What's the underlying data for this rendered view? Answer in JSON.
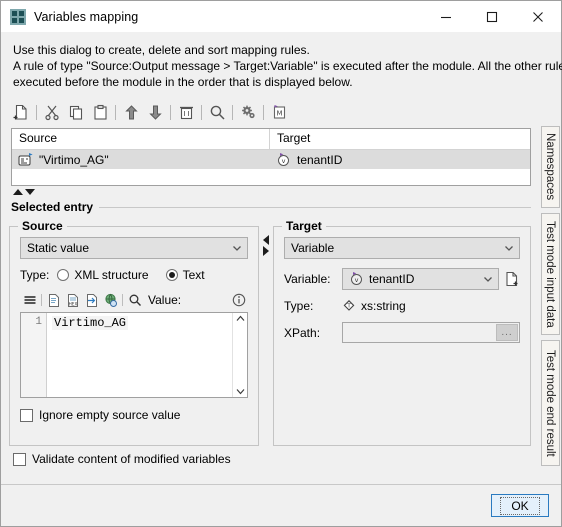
{
  "window": {
    "title": "Variables mapping",
    "icon": "app-icon",
    "controls": {
      "minimize": "minimize-icon",
      "maximize": "maximize-icon",
      "close": "close-icon"
    }
  },
  "description": {
    "line1": "Use this dialog to create, delete and sort mapping rules.",
    "line2": "A rule of type \"Source:Output message > Target:Variable\" is executed after the module. All the other rules get",
    "line3": "executed before the module in the order that is displayed below."
  },
  "toolbar": {
    "buttons": [
      {
        "name": "new-rule-icon",
        "tip": "New"
      },
      {
        "name": "cut-icon",
        "tip": "Cut"
      },
      {
        "name": "copy-icon",
        "tip": "Copy"
      },
      {
        "name": "paste-icon",
        "tip": "Paste"
      },
      {
        "name": "move-up-icon",
        "tip": "Move up"
      },
      {
        "name": "move-down-icon",
        "tip": "Move down"
      },
      {
        "name": "delete-icon",
        "tip": "Delete"
      },
      {
        "name": "search-icon",
        "tip": "Search"
      },
      {
        "name": "settings-icon",
        "tip": "Settings"
      },
      {
        "name": "module-icon",
        "tip": "Module"
      }
    ]
  },
  "rules_table": {
    "columns": [
      "Source",
      "Target"
    ],
    "rows": [
      {
        "source": "\"Virtimo_AG\"",
        "source_icon": "static-value-icon",
        "target": "tenantID",
        "target_icon": "variable-icon",
        "selected": true
      }
    ]
  },
  "selected_entry": {
    "legend": "Selected entry",
    "source": {
      "legend": "Source",
      "type_combo_value": "Static value",
      "type_label": "Type:",
      "radio_xml_label": "XML structure",
      "radio_text_label": "Text",
      "selected_radio": "Text",
      "mini_toolbar": [
        {
          "name": "format-lines-icon"
        },
        {
          "name": "document-icon"
        },
        {
          "name": "hex-document-icon"
        },
        {
          "name": "import-document-icon"
        },
        {
          "name": "link-globe-icon"
        },
        {
          "name": "search-icon"
        }
      ],
      "value_label": "Value:",
      "info_icon": "info-icon",
      "editor": {
        "line_number": "1",
        "text": "Virtimo_AG"
      },
      "ignore_empty_label": "Ignore empty source value",
      "ignore_empty_checked": false
    },
    "target": {
      "legend": "Target",
      "type_combo_value": "Variable",
      "variable_label": "Variable:",
      "variable_value": "tenantID",
      "variable_icon": "variable-icon",
      "new_variable_icon": "new-document-icon",
      "type_label": "Type:",
      "type_value": "xs:string",
      "type_value_icon": "type-icon",
      "xpath_label": "XPath:",
      "xpath_value": "",
      "xpath_browse_label": "..."
    }
  },
  "side_tabs": [
    {
      "label": "Namespaces"
    },
    {
      "label": "Test mode input data"
    },
    {
      "label": "Test mode end result"
    }
  ],
  "footer": {
    "validate_label": "Validate content of modified variables",
    "validate_checked": false,
    "ok_label": "OK"
  },
  "colors": {
    "window_bg": "#f0f0f0",
    "titlebar_bg": "#ffffff",
    "selection_row": "#dcdcdc",
    "combo_bg": "#e1e1e1",
    "ok_accent": "#2a7ac0",
    "tab_bg": "#f6f4f0"
  }
}
